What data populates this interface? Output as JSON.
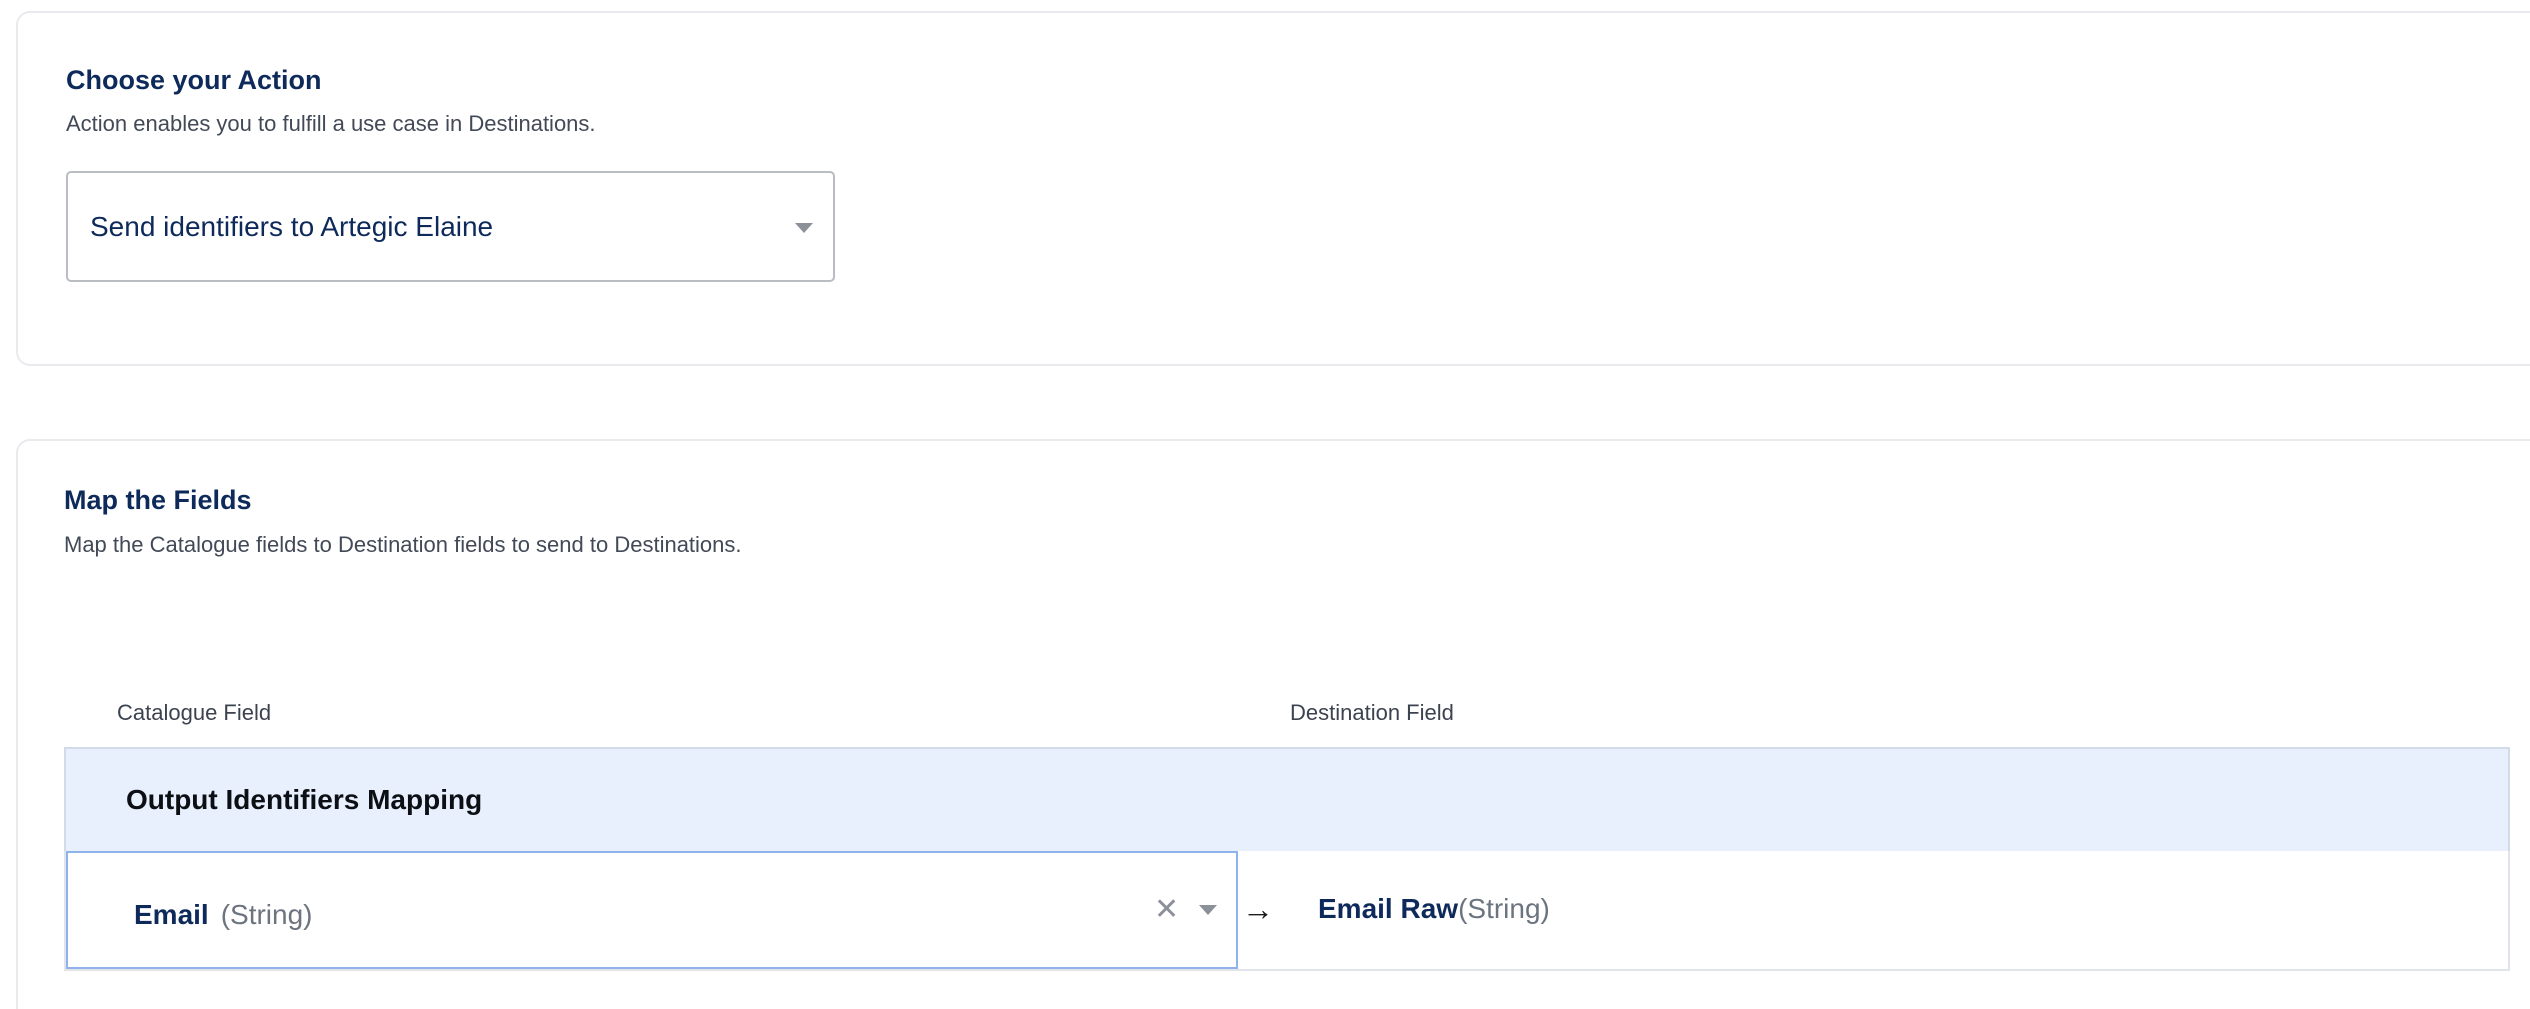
{
  "action_section": {
    "title": "Choose your Action",
    "subtitle": "Action enables you to fulfill a use case in Destinations.",
    "selected_action": "Send identifiers to Artegic Elaine"
  },
  "map_section": {
    "title": "Map the Fields",
    "subtitle": "Map the Catalogue fields to Destination fields to send to Destinations.",
    "columns": {
      "catalogue": "Catalogue Field",
      "destination": "Destination Field"
    },
    "group": {
      "label": "Output Identifiers Mapping",
      "mappings": [
        {
          "catalogue_field": "Email",
          "catalogue_type": "(String)",
          "destination_field": "Email Raw",
          "destination_type": "(String)"
        }
      ]
    }
  },
  "icons": {
    "clear": "close-icon",
    "dropdown": "chevron-down-icon",
    "arrow": "arrow-right-icon"
  },
  "colors": {
    "heading": "#0e2a5a",
    "group_background": "#e8effd",
    "focus_border": "#8fb2ea"
  }
}
